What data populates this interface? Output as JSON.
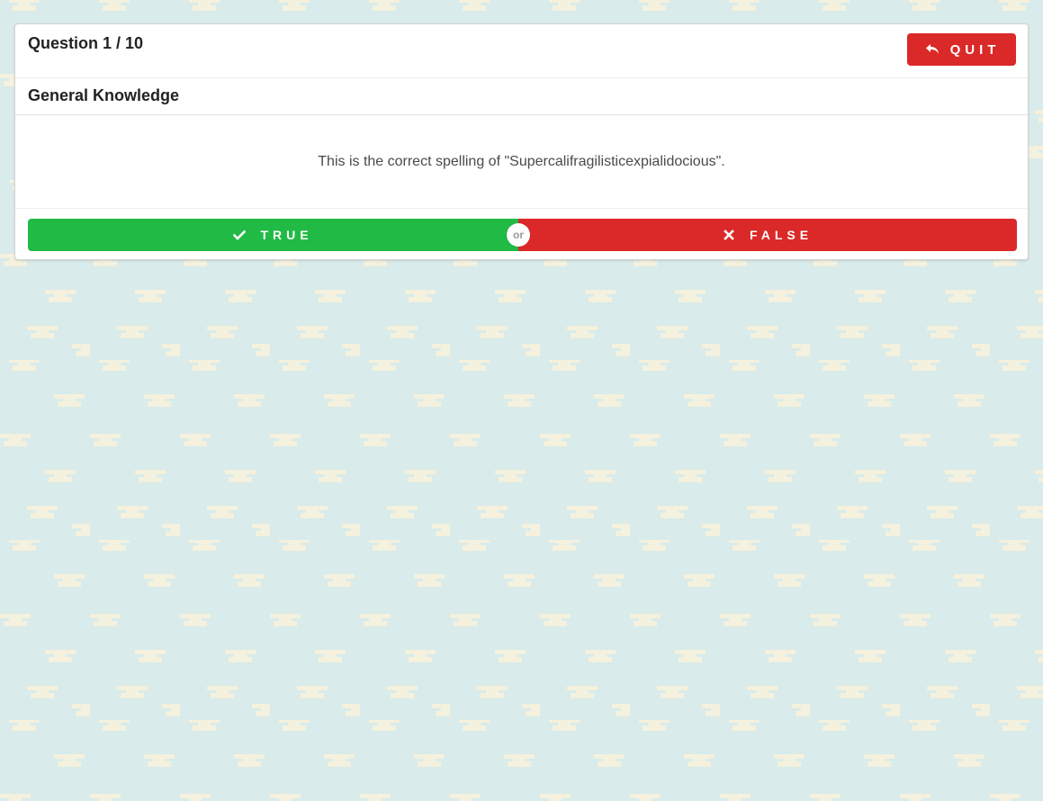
{
  "quiz": {
    "counter": "Question 1 / 10",
    "category": "General Knowledge",
    "question": "This is the correct spelling of \"Supercalifragilisticexpialidocious\"."
  },
  "header": {
    "quit_label": "QUIT",
    "quit_icon": "reply-arrow-icon"
  },
  "answers": {
    "true_label": "TRUE",
    "true_icon": "checkmark-icon",
    "false_label": "FALSE",
    "false_icon": "close-x-icon",
    "divider_label": "or"
  },
  "colors": {
    "background": "#d9ebea",
    "pattern": "#f4f1de",
    "true": "#21ba45",
    "false": "#db2828",
    "quit": "#db2828"
  }
}
